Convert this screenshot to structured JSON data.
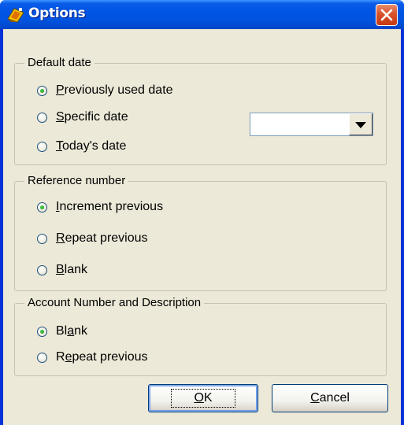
{
  "window": {
    "title": "Options",
    "close_label": "✕"
  },
  "groups": {
    "default_date": {
      "label": "Default date",
      "options": [
        {
          "label_prefix": "",
          "mnemonic": "P",
          "label_rest": "reviously used date",
          "checked": true
        },
        {
          "label_prefix": "",
          "mnemonic": "S",
          "label_rest": "pecific date",
          "checked": false
        },
        {
          "label_prefix": "",
          "mnemonic": "T",
          "label_rest": "oday's date",
          "checked": false
        }
      ],
      "date_value": ""
    },
    "reference_number": {
      "label": "Reference number",
      "options": [
        {
          "mnemonic": "I",
          "label_rest": "ncrement previous",
          "checked": true
        },
        {
          "mnemonic": "R",
          "label_rest": "epeat previous",
          "checked": false
        },
        {
          "mnemonic": "B",
          "label_rest": "lank",
          "checked": false
        }
      ]
    },
    "account": {
      "label": "Account Number and Description",
      "options": [
        {
          "label_prefix": "Bl",
          "mnemonic": "a",
          "label_rest": "nk",
          "checked": true
        },
        {
          "label_prefix": "R",
          "mnemonic": "e",
          "label_rest": "peat previous",
          "checked": false
        }
      ]
    }
  },
  "buttons": {
    "ok": {
      "mnemonic": "O",
      "label_rest": "K"
    },
    "cancel": {
      "mnemonic": "C",
      "label_rest": "ancel"
    }
  },
  "colors": {
    "titlebar": "#0054e3",
    "dialog_bg": "#ece9d8",
    "close": "#d9532c",
    "radio_dot": "#21a121"
  }
}
